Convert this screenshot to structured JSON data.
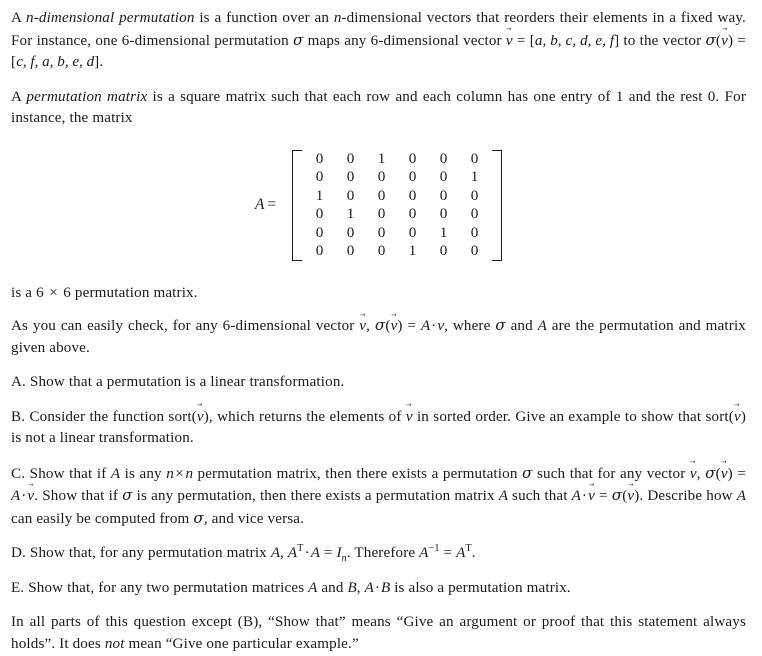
{
  "document": {
    "type": "math-problem-set",
    "topic": "Permutations and permutation matrices",
    "background_color": "#ffffff",
    "text_color": "#1a1a1a"
  },
  "paragraphs": {
    "intro_p1": {
      "s1": "A ",
      "term": "n-dimensional permutation",
      "s2": " is a function over an ",
      "n1": "n",
      "s3": "-dimensional vectors that reorders their elements in a fixed way.  For instance, one 6-dimensional permutation ",
      "sigma": "σ",
      "s4": " maps any 6-dimensional vector ",
      "vec_v": "v",
      "eq1": " = [",
      "components_in": "a, b, c, d, e, f",
      "s5": "] to the vector ",
      "sigma2": "σ",
      "s6": "(",
      "vec_v2": "v",
      "s7": ") = [",
      "components_out": "c, f, a, b, e, d",
      "s8": "]."
    },
    "intro_p2": {
      "s1": "A ",
      "term": "permutation matrix",
      "s2": " is a square matrix such that each row and each column has one entry of 1 and the rest 0.  For instance, the matrix"
    },
    "caption": {
      "s1": "is a 6 ",
      "times": "×",
      "s2": " 6 permutation matrix."
    },
    "check_p": {
      "s1": "As you can easily check, for any 6-dimensional vector ",
      "vec_v": "v",
      "s2": ", ",
      "sigma": "σ",
      "s3": "(",
      "vec_v2": "v",
      "s4": ") = ",
      "A": "A",
      "dot": "·",
      "v": "v",
      "s5": ", where ",
      "sigma2": "σ",
      "s6": " and ",
      "A2": "A",
      "s7": " are the permutation and matrix given above."
    }
  },
  "matrix": {
    "label": "A",
    "equals": "=",
    "rows": [
      [
        "0",
        "0",
        "1",
        "0",
        "0",
        "0"
      ],
      [
        "0",
        "0",
        "0",
        "0",
        "0",
        "1"
      ],
      [
        "1",
        "0",
        "0",
        "0",
        "0",
        "0"
      ],
      [
        "0",
        "1",
        "0",
        "0",
        "0",
        "0"
      ],
      [
        "0",
        "0",
        "0",
        "0",
        "1",
        "0"
      ],
      [
        "0",
        "0",
        "0",
        "1",
        "0",
        "0"
      ]
    ],
    "size": "6 x 6"
  },
  "questions": {
    "A": {
      "label": "A.",
      "text": " Show that a permutation is a linear transformation."
    },
    "B": {
      "label": "B.",
      "s1": " Consider the function sort(",
      "vec_v": "v",
      "s2": "), which returns the elements of ",
      "vec_v2": "v",
      "s3": " in sorted order.  Give an example to show that sort(",
      "vec_v3": "v",
      "s4": ") is not a linear transformation."
    },
    "C": {
      "label": "C.",
      "s1": " Show that if ",
      "A": "A",
      "s2": " is any ",
      "n1": "n",
      "times": "×",
      "n2": "n",
      "s3": " permutation matrix, then there exists a permutation ",
      "sigma": "σ",
      "s4": " such that for any vector ",
      "vec_v": "v",
      "s5": ", ",
      "sigma2": "σ",
      "s6": "(",
      "vec_v2": "v",
      "s7": ") = ",
      "A2": "A",
      "dot": "·",
      "vec_v3": "v",
      "s8": ".  Show that if ",
      "sigma3": "σ",
      "s9": " is any permutation, then there exists a permutation matrix ",
      "A3": "A",
      "s10": " such that ",
      "A4": "A",
      "dot2": "·",
      "vec_v4": "v",
      "s11": " = ",
      "sigma4": "σ",
      "s12": "(",
      "vec_v5": "v",
      "s13": ").  Describe how ",
      "A5": "A",
      "s14": " can easily be computed from ",
      "sigma5": "σ",
      "s15": ", and vice versa."
    },
    "D": {
      "label": "D.",
      "s1": " Show that, for any permutation matrix ",
      "A": "A",
      "s2": ", ",
      "A2": "A",
      "sup_T": "T",
      "dot": "·",
      "A3": "A",
      "s3": " = ",
      "I": "I",
      "sub_n": "n",
      "s4": ".  Therefore ",
      "A4": "A",
      "sup_inv": "−1",
      "s5": " = ",
      "A5": "A",
      "sup_T2": "T",
      "s6": "."
    },
    "E": {
      "label": "E.",
      "s1": " Show that, for any two permutation matrices ",
      "A": "A",
      "s2": " and ",
      "B": "B",
      "s3": ", ",
      "A2": "A",
      "dot": "·",
      "B2": "B",
      "s4": " is also a permutation matrix."
    }
  },
  "footer": {
    "s1": "In all parts of this question except (B), “Show that” means “Give an argument or proof that this statement always holds”.  It does ",
    "not": "not",
    "s2": " mean “Give one particular example.”"
  }
}
